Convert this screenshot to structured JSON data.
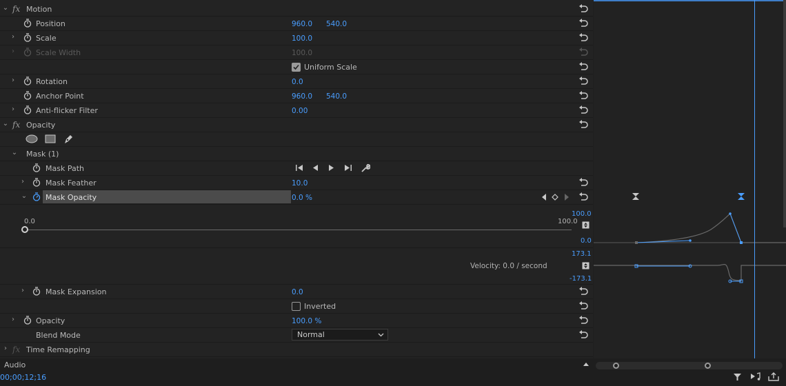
{
  "rows": {
    "motion": "Motion",
    "position": {
      "label": "Position",
      "x": "960.0",
      "y": "540.0"
    },
    "scale": {
      "label": "Scale",
      "value": "100.0"
    },
    "scale_width": {
      "label": "Scale Width",
      "value": "100.0"
    },
    "uniform_scale": {
      "label": "Uniform Scale",
      "checked": true
    },
    "rotation": {
      "label": "Rotation",
      "value": "0.0"
    },
    "anchor_point": {
      "label": "Anchor Point",
      "x": "960.0",
      "y": "540.0"
    },
    "anti_flicker": {
      "label": "Anti-flicker Filter",
      "value": "0.00"
    },
    "opacity_group": "Opacity",
    "mask": "Mask (1)",
    "mask_path": {
      "label": "Mask Path"
    },
    "mask_feather": {
      "label": "Mask Feather",
      "value": "10.0"
    },
    "mask_opacity": {
      "label": "Mask Opacity",
      "value": "0.0 %"
    },
    "slider": {
      "min_label": "0.0",
      "max_label": "100.0",
      "level": 0.0
    },
    "velocity": {
      "label": "Velocity: 0.0 / second"
    },
    "mask_expansion": {
      "label": "Mask Expansion",
      "value": "0.0"
    },
    "inverted": {
      "label": "Inverted",
      "checked": false
    },
    "opacity": {
      "label": "Opacity",
      "value": "100.0 %"
    },
    "blend_mode": {
      "label": "Blend Mode",
      "value": "Normal"
    },
    "time_remapping": "Time Remapping",
    "audio": "Audio"
  },
  "graph": {
    "value_top": "100.0",
    "value_bottom": "0.0",
    "velocity_top": "173.1",
    "velocity_bottom": "-173.1"
  },
  "status": {
    "timecode": "00;00;12;16"
  },
  "colors": {
    "accent": "#4a9eff",
    "panel": "#232323",
    "text": "#b9b9b9"
  }
}
